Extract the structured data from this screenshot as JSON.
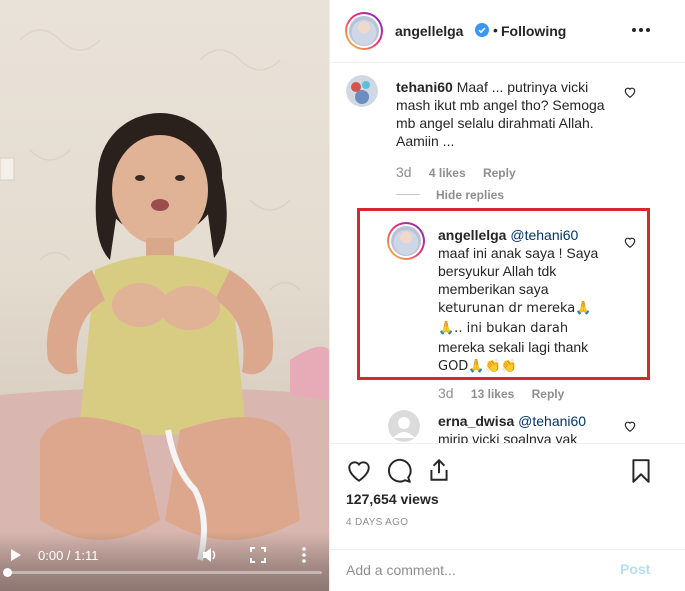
{
  "video": {
    "time": "0:00 / 1:11",
    "progress": 0.0,
    "icons": [
      "play-icon",
      "volume-icon",
      "fullscreen-icon",
      "more-vertical-icon"
    ]
  },
  "header": {
    "username": "angellelga",
    "separator": "•",
    "follow_status": "Following",
    "icons": [
      "verified-badge-icon",
      "more-horizontal-icon"
    ]
  },
  "comments": [
    {
      "username": "tehani60",
      "lines": [
        "Maaf ... putrinya vicki",
        "mash ikut mb angel tho? Semoga",
        "mb angel selalu dirahmati Allah.",
        "Aamiin ..."
      ],
      "age": "3d",
      "likes": "4 likes",
      "reply": "Reply"
    }
  ],
  "hide_replies": "Hide replies",
  "reply": {
    "username": "angellelga",
    "mention": "@tehani60",
    "lines": [
      "maaf ini anak saya ! Saya",
      "bersyukur Allah tdk",
      "memberikan saya",
      "keturunan dr mereka🙏",
      "🙏.. ini bukan darah",
      "mereka sekali lagi thank",
      "GOD🙏👏👏"
    ],
    "age": "3d",
    "likes": "13 likes",
    "reply": "Reply"
  },
  "comment2": {
    "username": "erna_dwisa",
    "mention": "@tehani60",
    "line2": "mirip vicki soalnya yak"
  },
  "actions": {
    "icons": [
      "heart-icon",
      "comment-icon",
      "share-icon",
      "bookmark-icon"
    ],
    "views": "127,654 views",
    "time_ago": "4 DAYS AGO"
  },
  "add_comment": {
    "placeholder": "Add a comment...",
    "post_label": "Post"
  },
  "colors": {
    "link": "#003569",
    "post_disabled": "#b2dffc",
    "highlight_border": "#d42a2f",
    "verified": "#3897f0"
  }
}
